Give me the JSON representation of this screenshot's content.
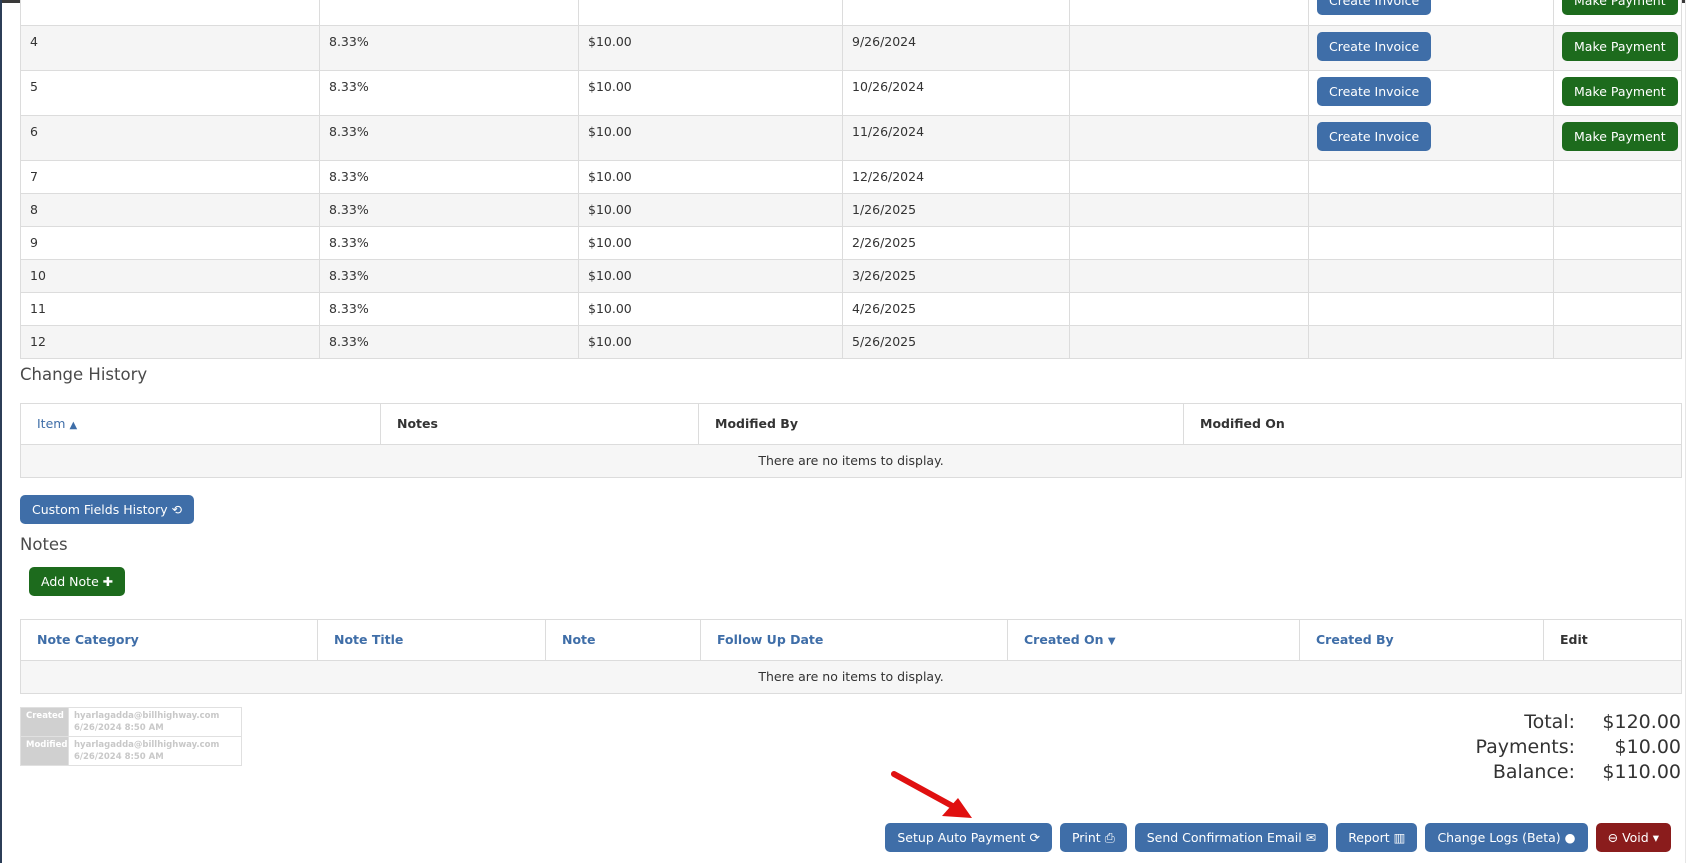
{
  "schedule": {
    "rows": [
      {
        "num": "",
        "pct": "",
        "amount": "",
        "date": "",
        "invoice": "Create Invoice",
        "payment": "Make Payment"
      },
      {
        "num": "4",
        "pct": "8.33%",
        "amount": "$10.00",
        "date": "9/26/2024",
        "invoice": "Create Invoice",
        "payment": "Make Payment"
      },
      {
        "num": "5",
        "pct": "8.33%",
        "amount": "$10.00",
        "date": "10/26/2024",
        "invoice": "Create Invoice",
        "payment": "Make Payment"
      },
      {
        "num": "6",
        "pct": "8.33%",
        "amount": "$10.00",
        "date": "11/26/2024",
        "invoice": "Create Invoice",
        "payment": "Make Payment"
      },
      {
        "num": "7",
        "pct": "8.33%",
        "amount": "$10.00",
        "date": "12/26/2024"
      },
      {
        "num": "8",
        "pct": "8.33%",
        "amount": "$10.00",
        "date": "1/26/2025"
      },
      {
        "num": "9",
        "pct": "8.33%",
        "amount": "$10.00",
        "date": "2/26/2025"
      },
      {
        "num": "10",
        "pct": "8.33%",
        "amount": "$10.00",
        "date": "3/26/2025"
      },
      {
        "num": "11",
        "pct": "8.33%",
        "amount": "$10.00",
        "date": "4/26/2025"
      },
      {
        "num": "12",
        "pct": "8.33%",
        "amount": "$10.00",
        "date": "5/26/2025"
      }
    ]
  },
  "change_history": {
    "title": "Change History",
    "columns": [
      "Item",
      "Notes",
      "Modified By",
      "Modified On"
    ],
    "empty": "There are no items to display."
  },
  "custom_fields_button": "Custom Fields History",
  "notes": {
    "title": "Notes",
    "add_button": "Add Note",
    "columns": [
      "Note Category",
      "Note Title",
      "Note",
      "Follow Up Date",
      "Created On",
      "Created By",
      "Edit"
    ],
    "empty": "There are no items to display."
  },
  "audit": {
    "created_label": "Created",
    "created_by": "hyarlagadda@billhighway.com",
    "created_on": "6/26/2024 8:50 AM",
    "modified_label": "Modified",
    "modified_by": "hyarlagadda@billhighway.com",
    "modified_on": "6/26/2024 8:50 AM"
  },
  "totals": {
    "total_label": "Total:",
    "total_value": "$120.00",
    "payments_label": "Payments:",
    "payments_value": "$10.00",
    "balance_label": "Balance:",
    "balance_value": "$110.00"
  },
  "actions": {
    "setup_auto_payment": "Setup Auto Payment",
    "print": "Print",
    "send_confirmation_email": "Send Confirmation Email",
    "report": "Report",
    "change_logs": "Change Logs (Beta)",
    "void": "Void"
  },
  "colors": {
    "primary_blue": "#3f6ea8",
    "green": "#1d6b1d",
    "void_red": "#8a1c1c",
    "arrow_red": "#e01010"
  }
}
